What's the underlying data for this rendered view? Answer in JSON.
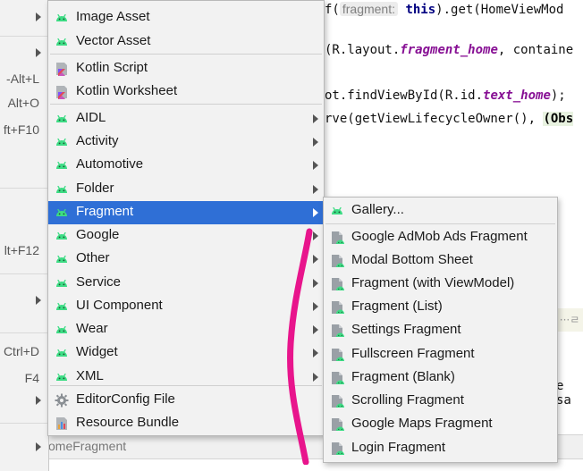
{
  "left_menu": {
    "shortcuts": [
      "-Alt+L",
      "Alt+O",
      "ft+F10",
      "lt+F12",
      "Ctrl+D",
      "F4"
    ]
  },
  "editor": {
    "line1": {
      "pre": "f(",
      "hint": "fragment:",
      "kw": "this",
      "post": ").get(HomeViewMod"
    },
    "line2": {
      "pre": "(R.layout.",
      "ital": "fragment_home",
      "post": ", containe"
    },
    "line3": {
      "pre": "ot.findViewById(R.id.",
      "ital": "text_home",
      "post": ");"
    },
    "line4": {
      "pre": "rve(getViewLifecycleOwner(), ",
      "hl": "(Obs"
    },
    "side_note": "···ㄹ",
    "side_text": "e sa",
    "bottom_tab_label": "omeFragment"
  },
  "new_menu": {
    "items": [
      {
        "label": "Image Asset",
        "icon": "android-icon",
        "submenu": false
      },
      {
        "label": "Vector Asset",
        "icon": "android-icon",
        "submenu": false
      },
      {
        "label": "Kotlin Script",
        "icon": "kotlin-icon",
        "submenu": false
      },
      {
        "label": "Kotlin Worksheet",
        "icon": "kotlin-icon",
        "submenu": false
      },
      {
        "label": "AIDL",
        "icon": "android-icon",
        "submenu": true
      },
      {
        "label": "Activity",
        "icon": "android-icon",
        "submenu": true
      },
      {
        "label": "Automotive",
        "icon": "android-icon",
        "submenu": true
      },
      {
        "label": "Folder",
        "icon": "android-icon",
        "submenu": true
      },
      {
        "label": "Fragment",
        "icon": "android-icon",
        "submenu": true,
        "selected": true
      },
      {
        "label": "Google",
        "icon": "android-icon",
        "submenu": true
      },
      {
        "label": "Other",
        "icon": "android-icon",
        "submenu": true
      },
      {
        "label": "Service",
        "icon": "android-icon",
        "submenu": true
      },
      {
        "label": "UI Component",
        "icon": "android-icon",
        "submenu": true
      },
      {
        "label": "Wear",
        "icon": "android-icon",
        "submenu": true
      },
      {
        "label": "Widget",
        "icon": "android-icon",
        "submenu": true
      },
      {
        "label": "XML",
        "icon": "android-icon",
        "submenu": true
      },
      {
        "label": "EditorConfig File",
        "icon": "gear-icon",
        "submenu": false
      },
      {
        "label": "Resource Bundle",
        "icon": "resource-bundle-icon",
        "submenu": false
      }
    ]
  },
  "fragment_menu": {
    "items": [
      {
        "label": "Gallery...",
        "icon": "android-icon"
      },
      {
        "label": "Google AdMob Ads Fragment",
        "icon": "android-file-icon"
      },
      {
        "label": "Modal Bottom Sheet",
        "icon": "android-file-icon"
      },
      {
        "label": "Fragment (with ViewModel)",
        "icon": "android-file-icon"
      },
      {
        "label": "Fragment (List)",
        "icon": "android-file-icon"
      },
      {
        "label": "Settings Fragment",
        "icon": "android-file-icon"
      },
      {
        "label": "Fullscreen Fragment",
        "icon": "android-file-icon"
      },
      {
        "label": "Fragment (Blank)",
        "icon": "android-file-icon"
      },
      {
        "label": "Scrolling Fragment",
        "icon": "android-file-icon"
      },
      {
        "label": "Google Maps Fragment",
        "icon": "android-file-icon"
      },
      {
        "label": "Login Fragment",
        "icon": "android-file-icon"
      }
    ]
  },
  "colors": {
    "selection": "#2f6fd6",
    "android_green": "#3ddc84",
    "annotation_pink": "#e8158c"
  }
}
